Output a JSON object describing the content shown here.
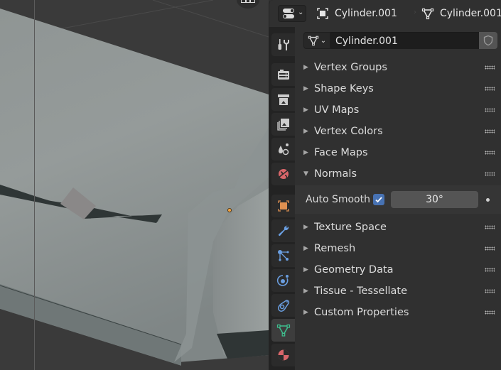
{
  "viewport": {
    "navigation_gizmo_icon": "grid-view-icon",
    "origin_point_color": "#f0a040"
  },
  "properties_header": {
    "editor_type_icon": "properties-editor-icon",
    "object_name": "Cylinder.001",
    "object_icon": "object-icon",
    "separator": "›",
    "mesh_name": "Cylinder.001",
    "mesh_icon": "mesh-data-icon"
  },
  "tabs": [
    {
      "name": "tool",
      "icon": "tool-icon",
      "active": false
    },
    {
      "name": "render",
      "icon": "render-icon",
      "active": false
    },
    {
      "name": "output",
      "icon": "output-icon",
      "active": false
    },
    {
      "name": "view-layer",
      "icon": "view-layer-icon",
      "active": false
    },
    {
      "name": "scene",
      "icon": "scene-icon",
      "active": false
    },
    {
      "name": "world",
      "icon": "world-icon",
      "active": false
    },
    {
      "name": "object",
      "icon": "object-icon",
      "active": false
    },
    {
      "name": "modifiers",
      "icon": "wrench-icon",
      "active": false
    },
    {
      "name": "particles",
      "icon": "particles-icon",
      "active": false
    },
    {
      "name": "physics",
      "icon": "physics-icon",
      "active": false
    },
    {
      "name": "constraints",
      "icon": "constraints-icon",
      "active": false
    },
    {
      "name": "data",
      "icon": "mesh-data-icon",
      "active": true
    },
    {
      "name": "material",
      "icon": "material-icon",
      "active": false
    }
  ],
  "datablock": {
    "name": "Cylinder.001",
    "type_chevron": "⌄",
    "fake_user_icon": "shield-icon"
  },
  "panels": [
    {
      "label": "Vertex Groups",
      "expanded": false
    },
    {
      "label": "Shape Keys",
      "expanded": false
    },
    {
      "label": "UV Maps",
      "expanded": false
    },
    {
      "label": "Vertex Colors",
      "expanded": false
    },
    {
      "label": "Face Maps",
      "expanded": false
    },
    {
      "label": "Normals",
      "expanded": true
    },
    {
      "label": "Texture Space",
      "expanded": false
    },
    {
      "label": "Remesh",
      "expanded": false
    },
    {
      "label": "Geometry Data",
      "expanded": false
    },
    {
      "label": "Tissue - Tessellate",
      "expanded": false
    },
    {
      "label": "Custom Properties",
      "expanded": false
    }
  ],
  "arrows": {
    "collapsed": "▶",
    "expanded": "▼"
  },
  "normals": {
    "auto_smooth_label": "Auto Smooth",
    "auto_smooth_checked": true,
    "angle_value": "30°"
  },
  "colors": {
    "accent_blue": "#4772b3",
    "active_tab_green": "#3ec08f",
    "world_red": "#d9666a"
  }
}
